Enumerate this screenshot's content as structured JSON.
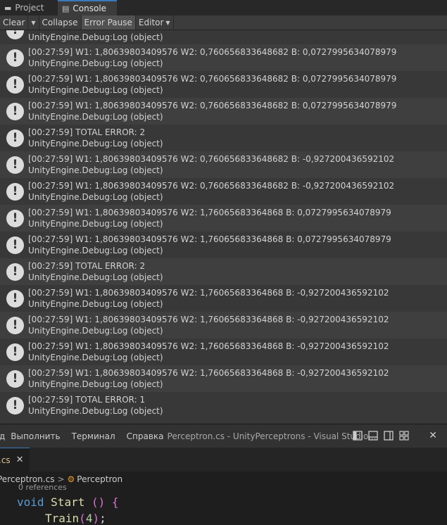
{
  "unity": {
    "tabs": [
      {
        "label": "Project",
        "icon": "folder-icon"
      },
      {
        "label": "Console",
        "icon": "console-icon"
      }
    ],
    "toolbar": {
      "clear": "Clear",
      "collapse": "Collapse",
      "error_pause": "Error Pause",
      "editor": "Editor"
    },
    "partial_first_row": "UnityEngine.Debug:Log (object)",
    "log_entries": [
      {
        "message": "[00:27:59] W1: 1,80639803409576 W2: 0,760656833648682 B: 0,0727995634078979",
        "stack": "UnityEngine.Debug:Log (object)"
      },
      {
        "message": "[00:27:59] W1: 1,80639803409576 W2: 0,760656833648682 B: 0,0727995634078979",
        "stack": "UnityEngine.Debug:Log (object)"
      },
      {
        "message": "[00:27:59] W1: 1,80639803409576 W2: 0,760656833648682 B: 0,0727995634078979",
        "stack": "UnityEngine.Debug:Log (object)"
      },
      {
        "message": "[00:27:59] TOTAL ERROR: 2",
        "stack": "UnityEngine.Debug:Log (object)"
      },
      {
        "message": "[00:27:59] W1: 1,80639803409576 W2: 0,760656833648682 B: -0,927200436592102",
        "stack": "UnityEngine.Debug:Log (object)"
      },
      {
        "message": "[00:27:59] W1: 1,80639803409576 W2: 0,760656833648682 B: -0,927200436592102",
        "stack": "UnityEngine.Debug:Log (object)"
      },
      {
        "message": "[00:27:59] W1: 1,80639803409576 W2: 1,76065683364868 B: 0,0727995634078979",
        "stack": "UnityEngine.Debug:Log (object)"
      },
      {
        "message": "[00:27:59] W1: 1,80639803409576 W2: 1,76065683364868 B: 0,0727995634078979",
        "stack": "UnityEngine.Debug:Log (object)"
      },
      {
        "message": "[00:27:59] TOTAL ERROR: 2",
        "stack": "UnityEngine.Debug:Log (object)"
      },
      {
        "message": "[00:27:59] W1: 1,80639803409576 W2: 1,76065683364868 B: -0,927200436592102",
        "stack": "UnityEngine.Debug:Log (object)"
      },
      {
        "message": "[00:27:59] W1: 1,80639803409576 W2: 1,76065683364868 B: -0,927200436592102",
        "stack": "UnityEngine.Debug:Log (object)"
      },
      {
        "message": "[00:27:59] W1: 1,80639803409576 W2: 1,76065683364868 B: -0,927200436592102",
        "stack": "UnityEngine.Debug:Log (object)"
      },
      {
        "message": "[00:27:59] W1: 1,80639803409576 W2: 1,76065683364868 B: -0,927200436592102",
        "stack": "UnityEngine.Debug:Log (object)"
      },
      {
        "message": "[00:27:59] TOTAL ERROR: 1",
        "stack": "UnityEngine.Debug:Log (object)"
      }
    ],
    "log_icon_glyph": "!"
  },
  "vscode": {
    "menu": {
      "item_partial": "д",
      "run": "Выполнить",
      "terminal": "Терминал",
      "help": "Справка"
    },
    "window_title": "Perceptron.cs - UnityPerceptrons - Visual Studio...",
    "close_glyph": "✕",
    "tab": {
      "label": ".cs",
      "close_glyph": "✕"
    },
    "breadcrumb": {
      "file": "Perceptron.cs",
      "separator": ">",
      "symbol": "Perceptron"
    },
    "codelens": "0 references",
    "code": {
      "kw_void": "void",
      "fn_start": "Start",
      "start_parens": "()",
      "brace_open": "{",
      "fn_train": "Train",
      "paren_open": "(",
      "arg": "4",
      "paren_close": ")",
      "semicolon": ";"
    }
  }
}
